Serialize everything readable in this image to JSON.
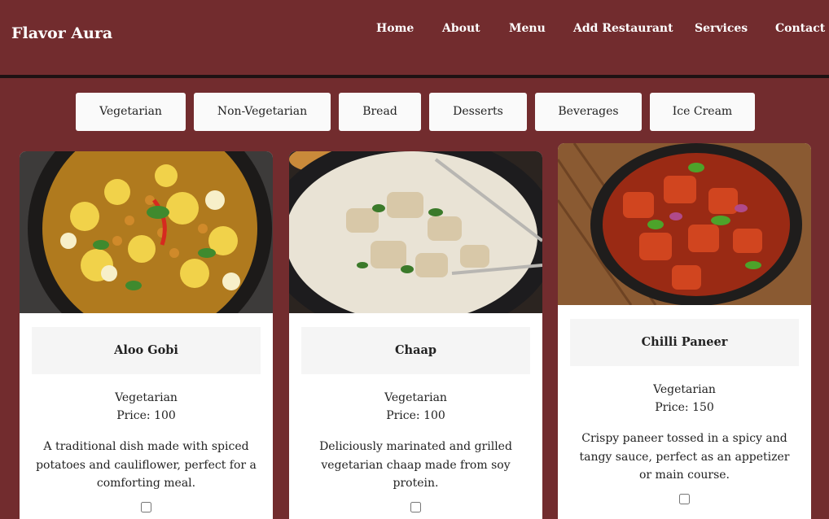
{
  "brand": "Flavor Aura",
  "nav": [
    "Home",
    "About",
    "Menu",
    "Add Restaurant",
    "Services",
    "Contact"
  ],
  "filters": [
    "Vegetarian",
    "Non-Vegetarian",
    "Bread",
    "Desserts",
    "Beverages",
    "Ice Cream"
  ],
  "cards": [
    {
      "title": "Aloo Gobi",
      "category": "Vegetarian",
      "price": "Price: 100",
      "description": "A traditional dish made with spiced potatoes and cauliflower, perfect for a comforting meal."
    },
    {
      "title": "Chaap",
      "category": "Vegetarian",
      "price": "Price: 100",
      "description": "Deliciously marinated and grilled vegetarian chaap made from soy protein."
    },
    {
      "title": "Chilli Paneer",
      "category": "Vegetarian",
      "price": "Price: 150",
      "description": "Crispy paneer tossed in a spicy and tangy sauce, perfect as an appetizer or main course."
    }
  ],
  "colors": {
    "background": "#722c2e",
    "card": "#ffffff",
    "filter_button": "#fafafa"
  }
}
